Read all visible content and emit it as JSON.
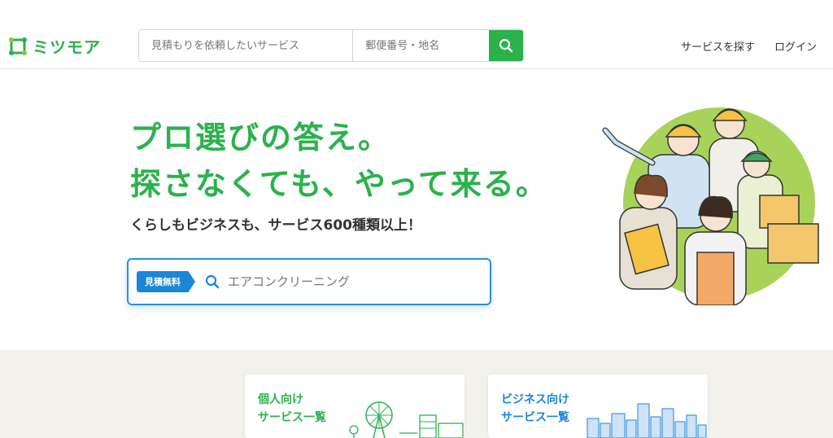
{
  "header": {
    "logo_text": "ミツモア",
    "search": {
      "service_placeholder": "見積もりを依頼したいサービス",
      "area_placeholder": "郵便番号・地名"
    },
    "nav": {
      "find_services": "サービスを探す",
      "login": "ログイン"
    }
  },
  "hero": {
    "title_line1": "プロ選びの答え。",
    "title_line2": "探さなくても、やって来る。",
    "subtitle": "くらしもビジネスも、サービス600種類以上！",
    "search": {
      "badge": "見積無料",
      "placeholder": "エアコンクリーニング"
    }
  },
  "categories": {
    "personal": {
      "line1": "個人向け",
      "line2": "サービス一覧"
    },
    "business": {
      "line1": "ビジネス向け",
      "line2": "サービス一覧"
    }
  },
  "colors": {
    "brand_green": "#2bb24c",
    "accent_blue": "#1a86d9",
    "section_bg": "#f3f1ec"
  },
  "icons": [
    "logo-icon",
    "search-icon",
    "workers-illustration",
    "park-illustration",
    "city-illustration"
  ]
}
